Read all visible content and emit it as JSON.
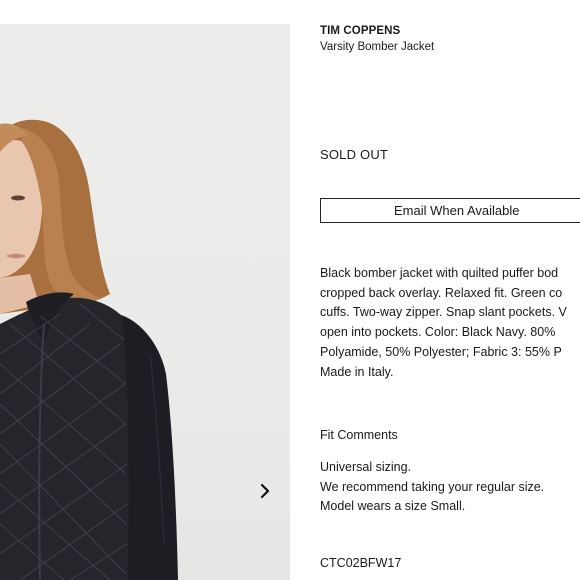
{
  "product": {
    "brand": "TIM COPPENS",
    "name": "Varsity Bomber Jacket",
    "status": "SOLD OUT",
    "email_button": "Email When Available",
    "description_lines": [
      "Black bomber jacket with quilted puffer bod",
      "cropped back overlay. Relaxed fit. Green co",
      "cuffs. Two-way zipper. Snap slant pockets. V",
      "open into pockets. Color: Black Navy. 80%",
      "Polyamide, 50% Polyester; Fabric 3: 55% P",
      "Made in Italy."
    ],
    "fit_title": "Fit Comments",
    "fit_lines": [
      "Universal sizing.",
      "We recommend taking your regular size.",
      "Model wears a size Small."
    ],
    "sku": "CTC02BFW17"
  },
  "gallery": {
    "next_icon": "chevron-right-icon"
  },
  "colors": {
    "background": "#ffffff",
    "photo_bg": "#ebebe9",
    "jacket": "#232428",
    "hair": "#b07a4a",
    "text": "#1a1a1a"
  }
}
